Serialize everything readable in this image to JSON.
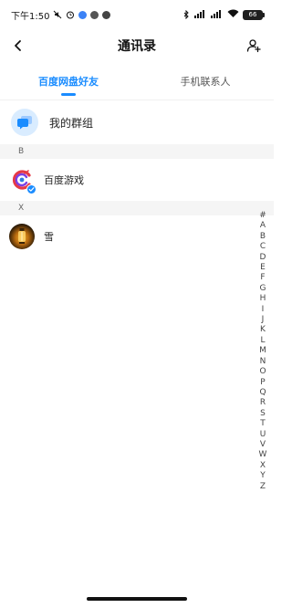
{
  "status_bar": {
    "time": "下午1:50",
    "battery": "66"
  },
  "header": {
    "title": "通讯录"
  },
  "tabs": [
    {
      "label": "百度网盘好友",
      "active": true
    },
    {
      "label": "手机联系人",
      "active": false
    }
  ],
  "groups": {
    "label": "我的群组",
    "icon": "chat-bubble-icon"
  },
  "sections": [
    {
      "letter": "B",
      "contacts": [
        {
          "name": "百度游戏",
          "avatar": "baidu-game-logo",
          "verified": true
        }
      ]
    },
    {
      "letter": "X",
      "contacts": [
        {
          "name": "雪",
          "avatar": "lantern-photo",
          "verified": false
        }
      ]
    }
  ],
  "alphabet_index": [
    "#",
    "A",
    "B",
    "C",
    "D",
    "E",
    "F",
    "G",
    "H",
    "I",
    "J",
    "K",
    "L",
    "M",
    "N",
    "O",
    "P",
    "Q",
    "R",
    "S",
    "T",
    "U",
    "V",
    "W",
    "X",
    "Y",
    "Z"
  ],
  "colors": {
    "accent": "#1a8cff",
    "section_bg": "#f5f5f5",
    "group_icon_bg": "#d9ecff"
  }
}
